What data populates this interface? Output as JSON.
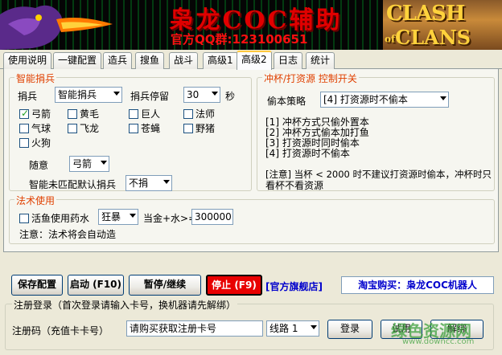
{
  "banner": {
    "title": "枭龙COC辅助",
    "qq": "官方QQ群:123100651",
    "logo_clash": "CLASH",
    "logo_of": "of",
    "logo_clans": "CLANS"
  },
  "tabs": [
    {
      "label": "使用说明",
      "active": false
    },
    {
      "label": "一键配置",
      "active": false
    },
    {
      "label": "造兵",
      "active": false
    },
    {
      "label": "搜鱼",
      "active": false
    },
    {
      "label": "战斗",
      "active": false
    },
    {
      "label": "高级1",
      "active": false
    },
    {
      "label": "高级2",
      "active": true
    },
    {
      "label": "日志",
      "active": false
    },
    {
      "label": "统计",
      "active": false
    }
  ],
  "smart_donate": {
    "title": "智能捐兵",
    "donate_label": "捐兵",
    "donate_value": "智能捐兵",
    "stay_label": "捐兵停留",
    "stay_value": "30",
    "stay_unit": "秒",
    "troops": [
      {
        "label": "弓箭",
        "checked": true
      },
      {
        "label": "黄毛",
        "checked": false
      },
      {
        "label": "巨人",
        "checked": false
      },
      {
        "label": "法师",
        "checked": false
      },
      {
        "label": "气球",
        "checked": false
      },
      {
        "label": "飞龙",
        "checked": false
      },
      {
        "label": "苍蝇",
        "checked": false
      },
      {
        "label": "野猪",
        "checked": false
      },
      {
        "label": "火狗",
        "checked": false
      }
    ],
    "random_label": "随意",
    "random_value": "弓箭",
    "default_label": "智能未匹配默认捐兵",
    "default_value": "不捐"
  },
  "trophy": {
    "title": "冲杯/打资源 控制开关",
    "strategy_label": "偷本策略",
    "strategy_value": "[4] 打资源时不偷本",
    "lines": [
      "[1] 冲杯方式只偷外置本",
      "[2] 冲杯方式偷本加打鱼",
      "[3] 打资源时同时偷本",
      "[4] 打资源时不偷本"
    ],
    "note_line1": "[注意] 当杯 < 2000 时不建议打资源时偷本，冲杯时只",
    "note_line2": "看杯不看资源"
  },
  "spell": {
    "title": "法术使用",
    "potion_label": "活鱼使用药水",
    "potion_value": "狂暴",
    "threshold_label": "当金+水>=",
    "threshold_value": "300000",
    "note": "注意：法术将会自动造"
  },
  "controls": {
    "save": "保存配置",
    "start": "启动 (F10)",
    "pause": "暂停/继续",
    "stop": "停止 (F9)",
    "official_store": "[官方旗舰店]",
    "taobao": "淘宝购买：枭龙COC机器人"
  },
  "register": {
    "title": "注册登录（首次登录请输入卡号，换机器请先解绑）",
    "code_label": "注册码（充值卡卡号）",
    "code_value": "请购买获取注册卡号",
    "line_value": "线路 1",
    "login": "登录",
    "trial": "试用",
    "unbind": "解绑"
  },
  "watermark": {
    "text": "绿色资源网",
    "url": "www.downcc.com"
  },
  "colors": {
    "accent": "#e04000",
    "stop_bg": "#e80000",
    "link": "#0000cc"
  }
}
